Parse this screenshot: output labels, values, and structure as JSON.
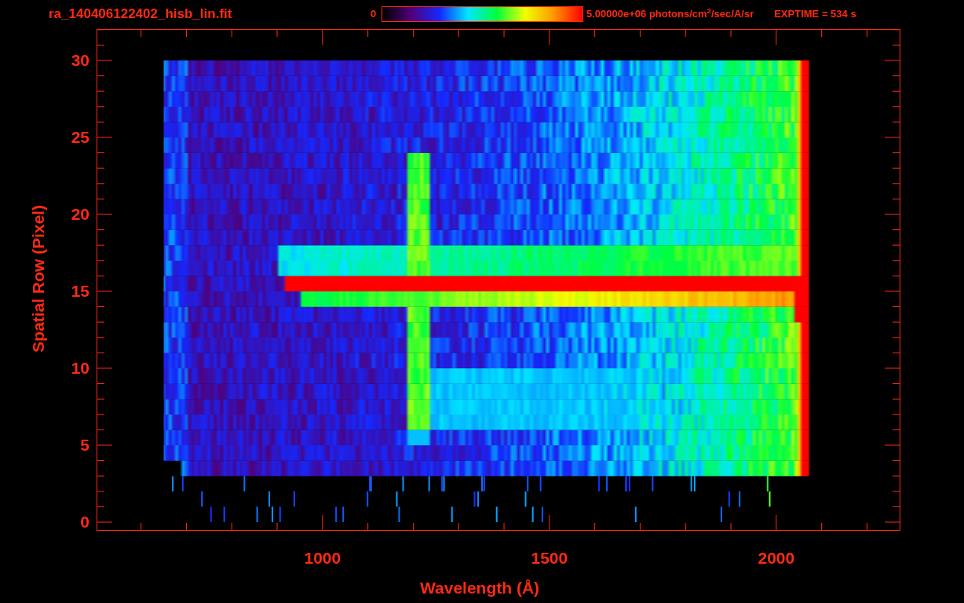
{
  "title": "ra_140406122402_hisb_lin.fit",
  "colorbar": {
    "min_label": "0",
    "max_label": "5.00000e+06 photons/cm$^{2}$/sec/A/sr"
  },
  "exptime": "EXPTIME = 534 s",
  "y_axis": {
    "title": "Spatial Row (Pixel)",
    "ticks": [
      "30",
      "25",
      "20",
      "15",
      "10",
      "5",
      "0"
    ]
  },
  "x_axis": {
    "title": "Wavelength (Å)",
    "ticks": [
      "1000",
      "1500",
      "2000"
    ]
  }
}
